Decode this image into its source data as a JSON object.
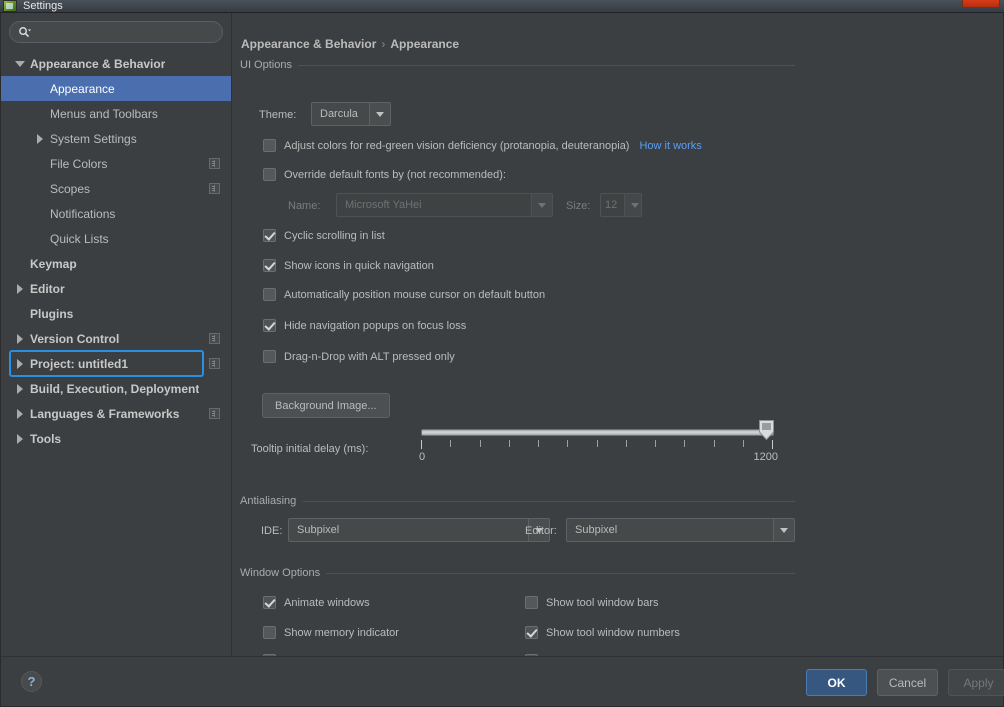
{
  "window": {
    "title": "Settings",
    "app_icon": "idea-icon",
    "close_icon": "close-icon"
  },
  "sidebar": {
    "search": {
      "placeholder": "",
      "value": "",
      "icon": "search-icon"
    },
    "focused_item_index": 12,
    "items": [
      {
        "label": "Appearance & Behavior",
        "indent": 0,
        "twisty": "down",
        "bold": true,
        "selected": false,
        "project_icon": false
      },
      {
        "label": "Appearance",
        "indent": 1,
        "twisty": "none",
        "bold": false,
        "selected": true,
        "project_icon": false
      },
      {
        "label": "Menus and Toolbars",
        "indent": 1,
        "twisty": "none",
        "bold": false,
        "selected": false,
        "project_icon": false
      },
      {
        "label": "System Settings",
        "indent": 1,
        "twisty": "right",
        "bold": false,
        "selected": false,
        "project_icon": false
      },
      {
        "label": "File Colors",
        "indent": 1,
        "twisty": "none",
        "bold": false,
        "selected": false,
        "project_icon": true
      },
      {
        "label": "Scopes",
        "indent": 1,
        "twisty": "none",
        "bold": false,
        "selected": false,
        "project_icon": true
      },
      {
        "label": "Notifications",
        "indent": 1,
        "twisty": "none",
        "bold": false,
        "selected": false,
        "project_icon": false
      },
      {
        "label": "Quick Lists",
        "indent": 1,
        "twisty": "none",
        "bold": false,
        "selected": false,
        "project_icon": false
      },
      {
        "label": "Keymap",
        "indent": 0,
        "twisty": "none",
        "bold": true,
        "selected": false,
        "project_icon": false
      },
      {
        "label": "Editor",
        "indent": 0,
        "twisty": "right",
        "bold": true,
        "selected": false,
        "project_icon": false
      },
      {
        "label": "Plugins",
        "indent": 0,
        "twisty": "none",
        "bold": true,
        "selected": false,
        "project_icon": false
      },
      {
        "label": "Version Control",
        "indent": 0,
        "twisty": "right",
        "bold": true,
        "selected": false,
        "project_icon": true
      },
      {
        "label": "Project: untitled1",
        "indent": 0,
        "twisty": "right",
        "bold": true,
        "selected": false,
        "project_icon": true
      },
      {
        "label": "Build, Execution, Deployment",
        "indent": 0,
        "twisty": "right",
        "bold": true,
        "selected": false,
        "project_icon": false
      },
      {
        "label": "Languages & Frameworks",
        "indent": 0,
        "twisty": "right",
        "bold": true,
        "selected": false,
        "project_icon": true
      },
      {
        "label": "Tools",
        "indent": 0,
        "twisty": "right",
        "bold": true,
        "selected": false,
        "project_icon": false
      }
    ]
  },
  "main": {
    "breadcrumb": {
      "root": "Appearance & Behavior",
      "separator": "›",
      "leaf": "Appearance"
    },
    "ui_options": {
      "section_label": "UI Options",
      "theme_label": "Theme:",
      "theme_value": "Darcula",
      "adjust_colors": {
        "label": "Adjust colors for red-green vision deficiency (protanopia, deuteranopia)",
        "checked": false,
        "link": "How it works"
      },
      "override_fonts": {
        "label": "Override default fonts by (not recommended):",
        "checked": false
      },
      "font_name_label": "Name:",
      "font_name_value": "Microsoft YaHei",
      "font_size_label": "Size:",
      "font_size_value": "12",
      "checkboxes": [
        {
          "label": "Cyclic scrolling in list",
          "checked": true
        },
        {
          "label": "Show icons in quick navigation",
          "checked": true
        },
        {
          "label": "Automatically position mouse cursor on default button",
          "checked": false
        },
        {
          "label": "Hide navigation popups on focus loss",
          "checked": true
        },
        {
          "label": "Drag-n-Drop with ALT pressed only",
          "checked": false
        }
      ],
      "background_image_button": "Background Image...",
      "tooltip_delay": {
        "label": "Tooltip initial delay (ms):",
        "min_label": "0",
        "max_label": "1200",
        "min": 0,
        "max": 1200,
        "value": 1200,
        "ticks": 13
      }
    },
    "antialiasing": {
      "section_label": "Antialiasing",
      "ide_label": "IDE:",
      "ide_value": "Subpixel",
      "editor_label": "Editor:",
      "editor_value": "Subpixel"
    },
    "window_options": {
      "section_label": "Window Options",
      "left_column": [
        {
          "label": "Animate windows",
          "checked": true
        },
        {
          "label": "Show memory indicator",
          "checked": false
        }
      ],
      "right_column": [
        {
          "label": "Show tool window bars",
          "checked": false
        },
        {
          "label": "Show tool window numbers",
          "checked": true
        }
      ]
    }
  },
  "footer": {
    "help_icon": "question-mark-icon",
    "ok": "OK",
    "cancel": "Cancel",
    "apply": "Apply",
    "apply_enabled": false
  },
  "colors": {
    "background": "#3c3f41",
    "selection": "#4b6eaf",
    "focus_ring": "#2a8fe0",
    "link": "#589df6",
    "primary_button": "#365880",
    "close_button": "#d33b17"
  }
}
